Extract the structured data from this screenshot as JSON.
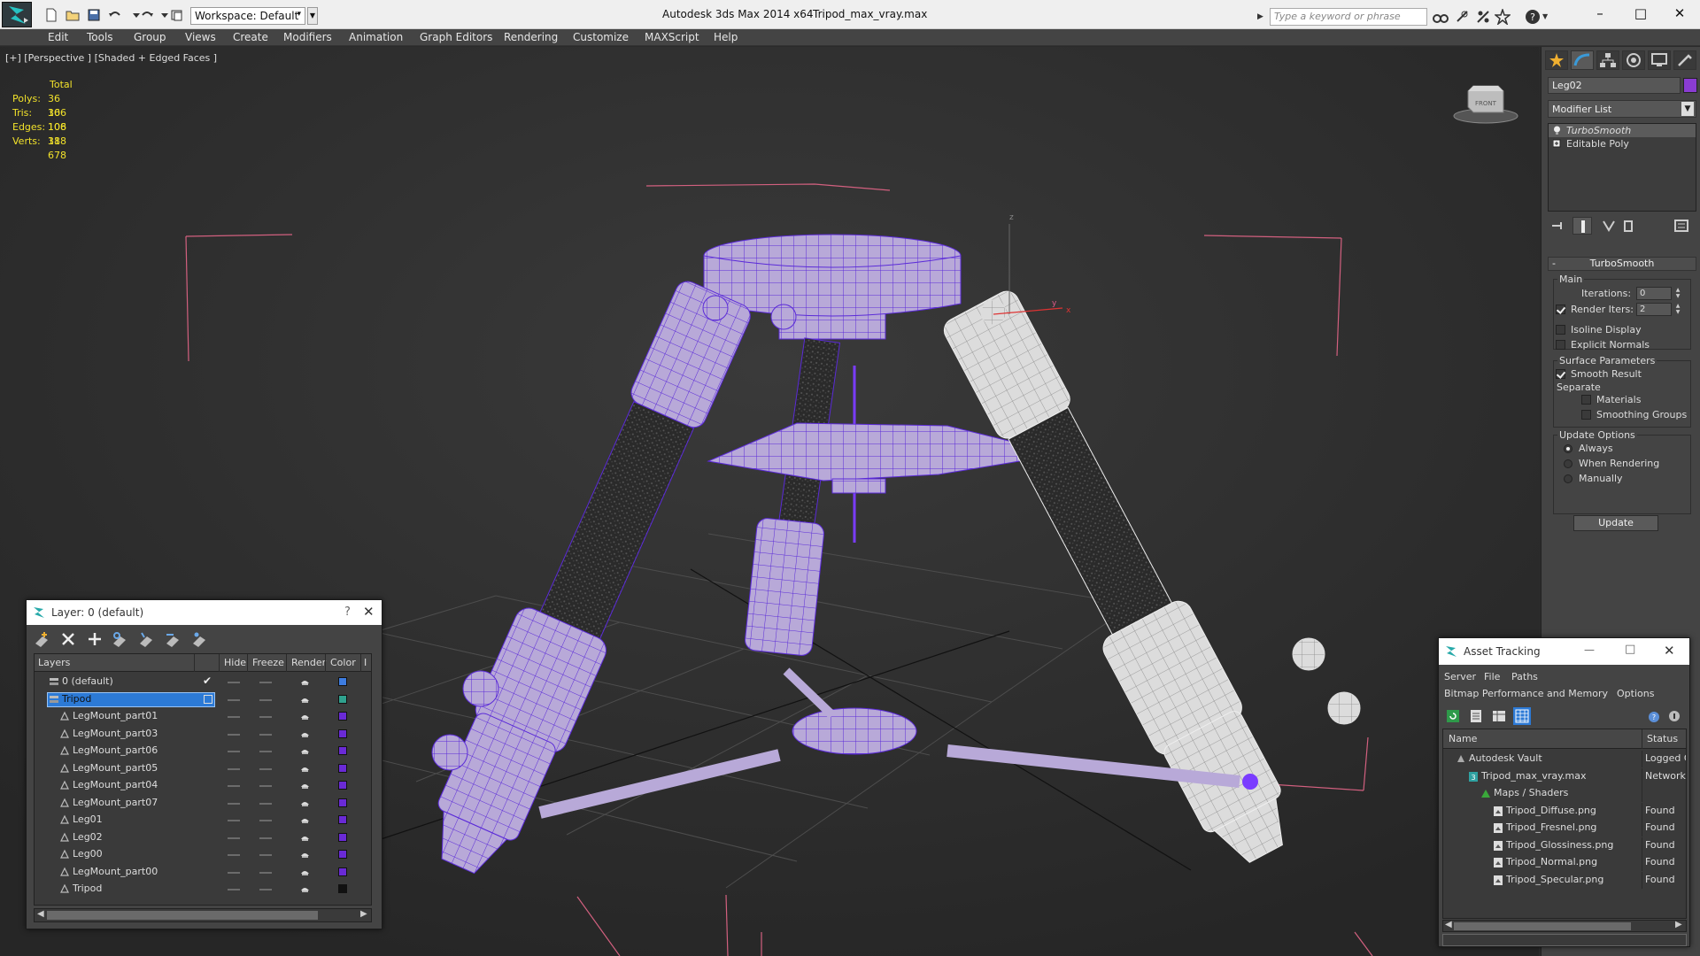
{
  "titlebar": {
    "app_title": "Autodesk 3ds Max  2014 x64",
    "file_name": "Tripod_max_vray.max",
    "workspace_label": "Workspace: Default",
    "search_placeholder": "Type a keyword or phrase",
    "minimize": "–",
    "maximize": "□",
    "close": "✕"
  },
  "menu": [
    "Edit",
    "Tools",
    "Group",
    "Views",
    "Create",
    "Modifiers",
    "Animation",
    "Graph Editors",
    "Rendering",
    "Customize",
    "MAXScript",
    "Help"
  ],
  "viewport": {
    "label": "[+] [Perspective ] [Shaded + Edged Faces ]",
    "stats_header": "Total",
    "stats": [
      {
        "key": "Polys:",
        "value": "36 106"
      },
      {
        "key": "Tris:",
        "value": "36 106"
      },
      {
        "key": "Edges:",
        "value": "108 318"
      },
      {
        "key": "Verts:",
        "value": "18 678"
      }
    ],
    "viewcube_label": "FRONT",
    "axis_labels": {
      "z": "z",
      "y": "y",
      "x": "x"
    },
    "colors": {
      "selected_wire": "#7a3cff",
      "gizmo": "#e05a8a",
      "grid": "#6e6e6e",
      "background": "#2f2f2f"
    }
  },
  "command_panel": {
    "object_name": "Leg02",
    "object_color": "#8a3cd2",
    "modifier_list": "Modifier List",
    "stack": [
      {
        "label": "TurboSmooth",
        "selected": true
      },
      {
        "label": "Editable Poly",
        "selected": false
      }
    ],
    "rollout_title": "TurboSmooth",
    "main_group": "Main",
    "iterations_label": "Iterations:",
    "iterations_value": "0",
    "render_iters_label": "Render Iters:",
    "render_iters_value": "2",
    "isoline_label": "Isoline Display",
    "explicit_normals_label": "Explicit Normals",
    "surface_group": "Surface Parameters",
    "smooth_result_label": "Smooth Result",
    "separate_label": "Separate",
    "materials_label": "Materials",
    "smoothing_groups_label": "Smoothing Groups",
    "update_group": "Update Options",
    "always_label": "Always",
    "when_rendering_label": "When Rendering",
    "manually_label": "Manually",
    "update_button": "Update"
  },
  "layer_dialog": {
    "title": "Layer: 0 (default)",
    "help": "?",
    "close": "✕",
    "columns": [
      "Layers",
      "Hide",
      "Freeze",
      "Render",
      "Color"
    ],
    "column_overflow": "I",
    "rows": [
      {
        "name": "0 (default)",
        "level": 0,
        "color": "#3d7ce0",
        "mark": "check"
      },
      {
        "name": "Tripod",
        "level": 0,
        "color": "#2fa18e",
        "mark": "box",
        "selected": true
      },
      {
        "name": "LegMount_part01",
        "level": 1,
        "color": "#6a2ad6"
      },
      {
        "name": "LegMount_part03",
        "level": 1,
        "color": "#6a2ad6"
      },
      {
        "name": "LegMount_part06",
        "level": 1,
        "color": "#6a2ad6"
      },
      {
        "name": "LegMount_part05",
        "level": 1,
        "color": "#6a2ad6"
      },
      {
        "name": "LegMount_part04",
        "level": 1,
        "color": "#6a2ad6"
      },
      {
        "name": "LegMount_part07",
        "level": 1,
        "color": "#6a2ad6"
      },
      {
        "name": "Leg01",
        "level": 1,
        "color": "#6a2ad6"
      },
      {
        "name": "Leg02",
        "level": 1,
        "color": "#6a2ad6"
      },
      {
        "name": "Leg00",
        "level": 1,
        "color": "#6a2ad6"
      },
      {
        "name": "LegMount_part00",
        "level": 1,
        "color": "#6a2ad6"
      },
      {
        "name": "Tripod",
        "level": 1,
        "color": "#111111"
      }
    ]
  },
  "asset_dialog": {
    "title": "Asset Tracking",
    "minimize": "—",
    "maximize": "□",
    "close": "✕",
    "menu": [
      "Server",
      "File",
      "Paths",
      "Bitmap Performance and Memory",
      "Options"
    ],
    "columns": [
      "Name",
      "Status"
    ],
    "rows": [
      {
        "name": "Autodesk Vault",
        "status": "Logged O",
        "level": 0,
        "icon": "vault-icon"
      },
      {
        "name": "Tripod_max_vray.max",
        "status": "Network",
        "level": 1,
        "icon": "max-file-icon"
      },
      {
        "name": "Maps / Shaders",
        "status": "",
        "level": 2,
        "icon": "maps-icon"
      },
      {
        "name": "Tripod_Diffuse.png",
        "status": "Found",
        "level": 3,
        "icon": "bitmap-icon"
      },
      {
        "name": "Tripod_Fresnel.png",
        "status": "Found",
        "level": 3,
        "icon": "bitmap-icon"
      },
      {
        "name": "Tripod_Glossiness.png",
        "status": "Found",
        "level": 3,
        "icon": "bitmap-icon"
      },
      {
        "name": "Tripod_Normal.png",
        "status": "Found",
        "level": 3,
        "icon": "bitmap-icon"
      },
      {
        "name": "Tripod_Specular.png",
        "status": "Found",
        "level": 3,
        "icon": "bitmap-icon"
      }
    ]
  }
}
